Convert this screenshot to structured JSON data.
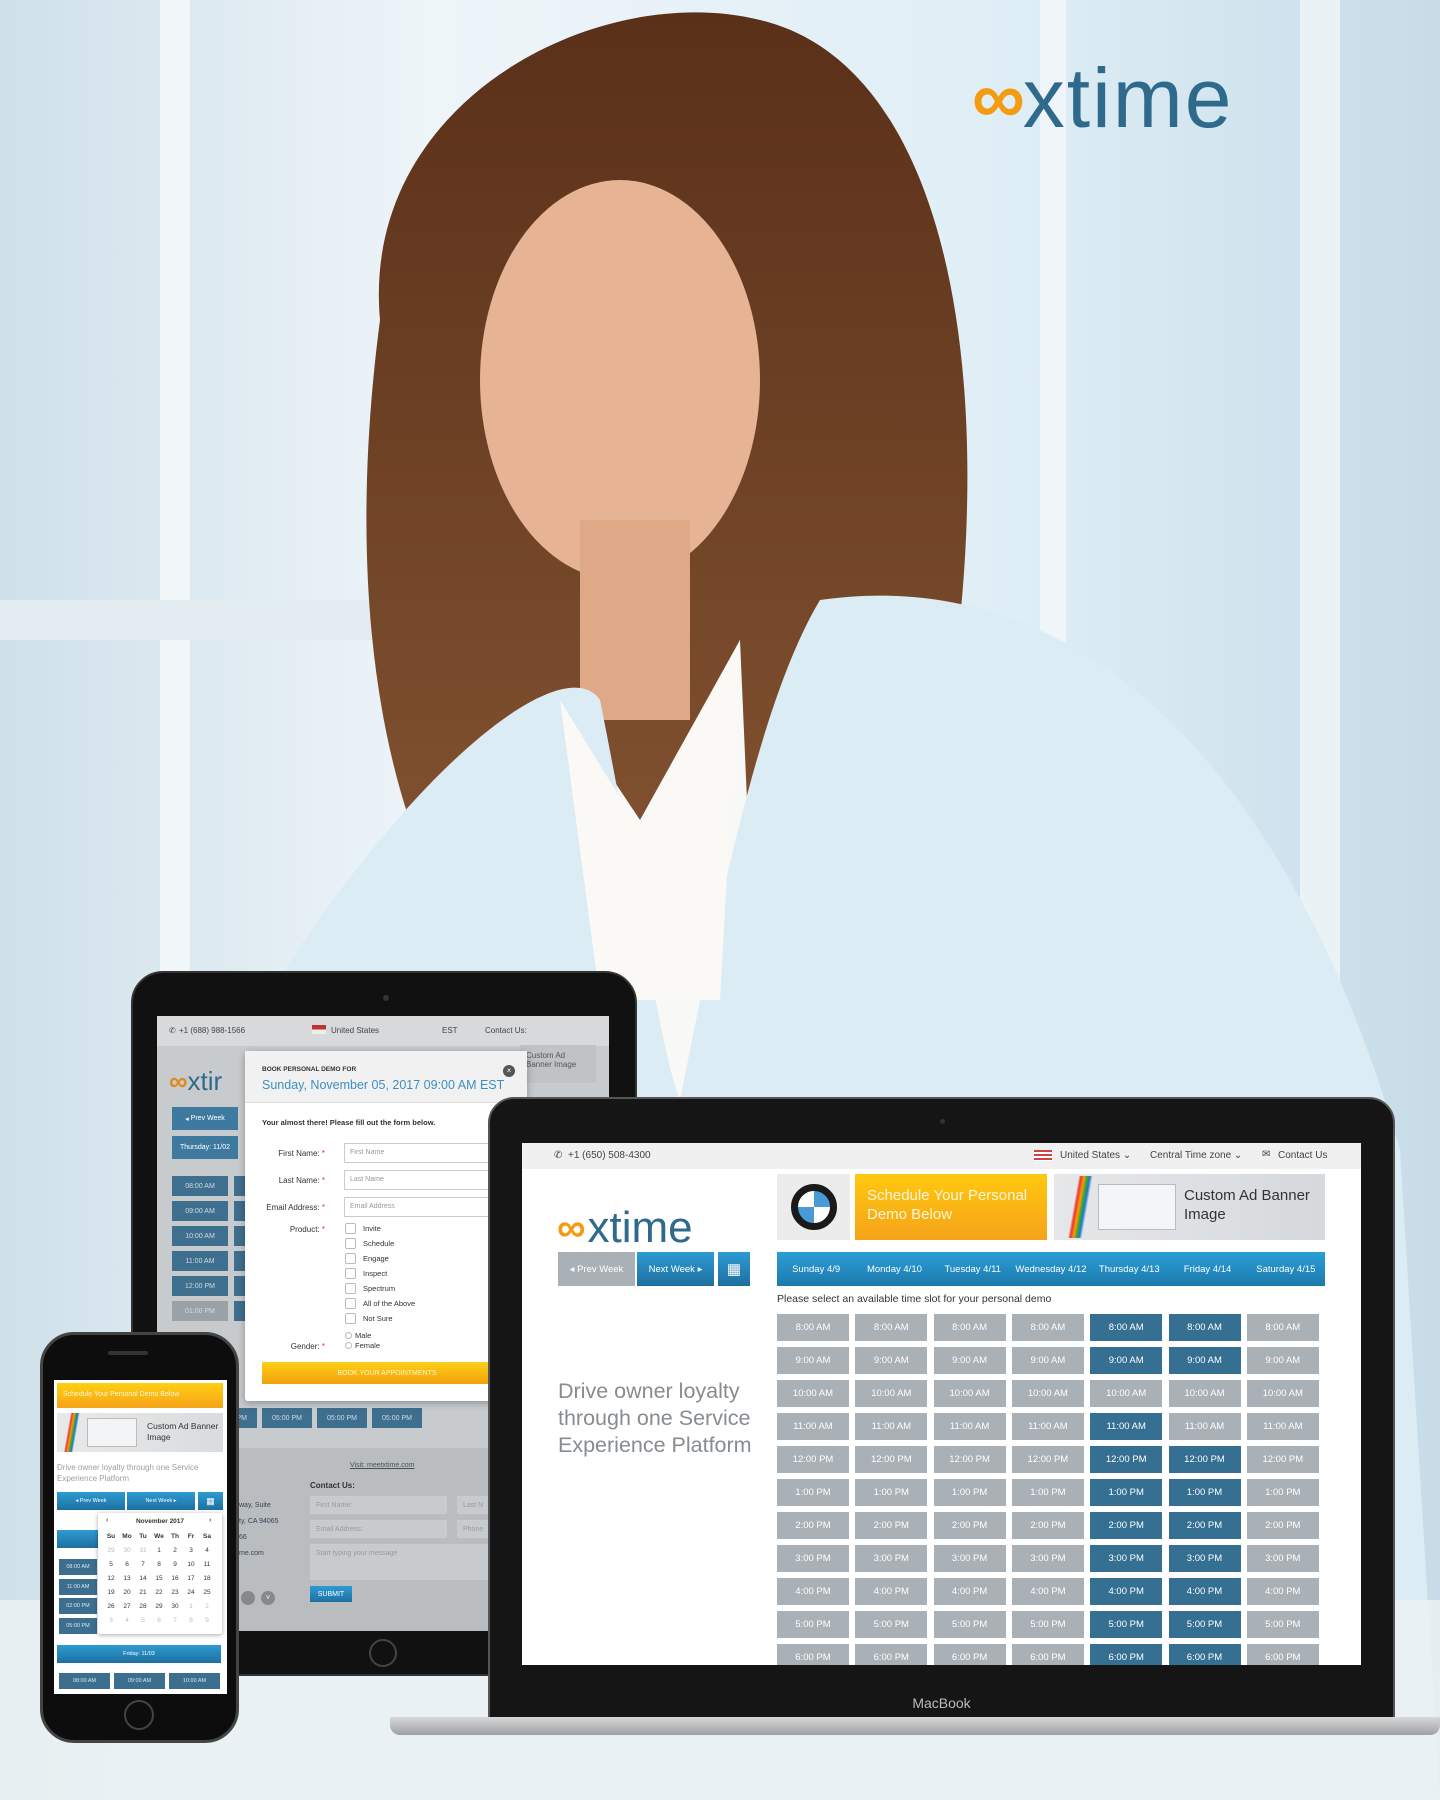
{
  "brand": {
    "logo_text": "xtime",
    "accent": "#f39c12",
    "primary": "#2f6a8c"
  },
  "laptop": {
    "device_label": "MacBook",
    "header": {
      "phone": "+1 (650) 508-4300",
      "country": "United States",
      "timezone": "Central Time zone",
      "contact": "Contact Us"
    },
    "promo_banner": "Schedule Your Personal Demo Below",
    "ad_banner": "Custom Ad Banner Image",
    "tagline": "Drive owner loyalty through one Service Experience Platform",
    "nav": {
      "prev": "Prev Week",
      "next": "Next Week"
    },
    "instruction": "Please select an available time slot for your personal demo",
    "times": [
      "8:00 AM",
      "9:00 AM",
      "10:00 AM",
      "11:00 AM",
      "12:00 PM",
      "1:00 PM",
      "2:00 PM",
      "3:00 PM",
      "4:00 PM",
      "5:00 PM",
      "6:00 PM"
    ],
    "days": [
      {
        "label": "Sunday 4/9",
        "highlighted": []
      },
      {
        "label": "Monday 4/10",
        "highlighted": []
      },
      {
        "label": "Tuesday 4/11",
        "highlighted": []
      },
      {
        "label": "Wednesday 4/12",
        "highlighted": []
      },
      {
        "label": "Thursday 4/13",
        "highlighted": [
          "8:00 AM",
          "9:00 AM",
          "11:00 AM",
          "12:00 PM",
          "1:00 PM",
          "2:00 PM",
          "3:00 PM",
          "4:00 PM",
          "5:00 PM",
          "6:00 PM"
        ]
      },
      {
        "label": "Friday 4/14",
        "highlighted": [
          "8:00 AM",
          "9:00 AM",
          "12:00 PM",
          "1:00 PM",
          "2:00 PM",
          "3:00 PM",
          "4:00 PM",
          "5:00 PM",
          "6:00 PM"
        ]
      },
      {
        "label": "Saturday 4/15",
        "highlighted": []
      }
    ]
  },
  "tablet": {
    "header": {
      "phone": "+1 (688) 988-1566",
      "country": "United States",
      "timezone": "EST",
      "contact": "Contact Us:"
    },
    "logo_partial": "xtir",
    "ad_banner": "Custom Ad Banner Image",
    "prev": "Prev Week",
    "day": "Thursday: 11/02",
    "slots": [
      "08:00 AM",
      "09:00 AM",
      "10:00 AM",
      "11:00 AM",
      "12:00 PM",
      "01:00 PM"
    ],
    "row_below": [
      "05:00 PM",
      "05:00 PM",
      "05:00 PM",
      "05:00 PM"
    ],
    "modal": {
      "title": "BOOK PERSONAL DEMO FOR",
      "datetime": "Sunday, November 05, 2017 09:00 AM EST",
      "intro": "Your almost there! Please fill out the form below.",
      "first_label": "First Name:",
      "first_placeholder": "First Name",
      "last_label": "Last Name:",
      "last_placeholder": "Last Name",
      "email_label": "Email Address:",
      "email_placeholder": "Email Address",
      "product_label": "Product:",
      "products": [
        "Invite",
        "Schedule",
        "Engage",
        "Inspect",
        "Spectrum",
        "All of the Above",
        "Not Sure"
      ],
      "gender_label": "Gender:",
      "genders": [
        "Male",
        "Female"
      ],
      "required_mark": "*",
      "submit": "BOOK YOUR APPOINTMENTS"
    },
    "footer": {
      "visit": "Visit: meetxtime.com",
      "address": [
        "way, Suite",
        "ty, CA 94065",
        "66",
        "me.com"
      ],
      "contact_title": "Contact Us:",
      "first": "First Name:",
      "last": "Last N",
      "email": "Email Address:",
      "phone": "Phone",
      "message": "Start typing your message",
      "submit": "SUBMIT"
    }
  },
  "phone": {
    "promo_banner": "Schedule Your Personal Demo Below",
    "ad_banner": "Custom Ad Banner Image",
    "tagline": "Drive owner loyalty through one Service Experience Platform",
    "prev": "Prev Week",
    "next": "Next Week",
    "calendar": {
      "month": "November 2017",
      "weekdays": [
        "Su",
        "Mo",
        "Tu",
        "We",
        "Th",
        "Fr",
        "Sa"
      ],
      "weeks": [
        [
          29,
          30,
          31,
          1,
          2,
          3,
          4
        ],
        [
          5,
          6,
          7,
          8,
          9,
          10,
          11
        ],
        [
          12,
          13,
          14,
          15,
          16,
          17,
          18
        ],
        [
          19,
          20,
          21,
          22,
          23,
          24,
          25
        ],
        [
          26,
          27,
          28,
          29,
          30,
          1,
          2
        ],
        [
          3,
          4,
          5,
          6,
          7,
          8,
          9
        ]
      ]
    },
    "slots": [
      "08:00 AM",
      "11:00 AM",
      "02:00 PM",
      "05:00 PM"
    ],
    "day2": "Friday: 11/03",
    "slots2": [
      "08:00 AM",
      "09:00 AM",
      "10:00 AM"
    ]
  }
}
